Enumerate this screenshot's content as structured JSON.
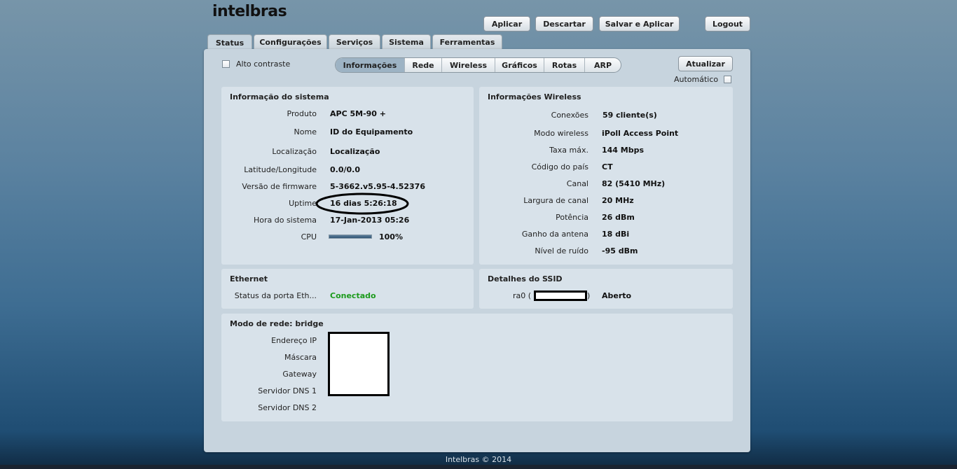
{
  "brand": "intelbras",
  "top_buttons": {
    "apply": "Aplicar",
    "discard": "Descartar",
    "save_apply": "Salvar e Aplicar",
    "logout": "Logout"
  },
  "main_tabs": [
    "Status",
    "Configurações",
    "Serviços",
    "Sistema",
    "Ferramentas"
  ],
  "high_contrast_label": "Alto contraste",
  "sub_tabs": [
    "Informações",
    "Rede",
    "Wireless",
    "Gráficos",
    "Rotas",
    "ARP"
  ],
  "update_button": "Atualizar",
  "auto_label": "Automático",
  "system_info": {
    "title": "Informação do sistema",
    "rows": [
      {
        "k": "Produto",
        "v": "APC 5M-90 +"
      },
      {
        "k": "Nome",
        "v": "ID do Equipamento"
      },
      {
        "k": "Localização",
        "v": "Localização"
      },
      {
        "k": "Latitude/Longitude",
        "v": "0.0/0.0"
      },
      {
        "k": "Versão de firmware",
        "v": "5-3662.v5.95-4.52376"
      },
      {
        "k": "Uptime",
        "v": "16 dias 5:26:18"
      },
      {
        "k": "Hora do sistema",
        "v": "17-Jan-2013 05:26"
      }
    ],
    "cpu_label": "CPU",
    "cpu_value": "100%",
    "cpu_fraction": 1.0
  },
  "wireless_info": {
    "title": "Informações Wireless",
    "rows": [
      {
        "k": "Conexões",
        "v": "59 cliente(s)"
      },
      {
        "k": "Modo wireless",
        "v": "iPoll Access Point"
      },
      {
        "k": "Taxa máx.",
        "v": "144 Mbps"
      },
      {
        "k": "Código do país",
        "v": "CT"
      },
      {
        "k": "Canal",
        "v": "82 (5410 MHz)"
      },
      {
        "k": "Largura de canal",
        "v": "20 MHz"
      },
      {
        "k": "Potência",
        "v": "26 dBm"
      },
      {
        "k": "Ganho da antena",
        "v": "18 dBi"
      },
      {
        "k": "Nível de ruído",
        "v": "-95 dBm"
      }
    ]
  },
  "ethernet": {
    "title": "Ethernet",
    "port_label": "Status da porta Eth...",
    "port_value": "Conectado",
    "status_color": "#1c9a1c"
  },
  "ssid": {
    "title": "Detalhes do SSID",
    "iface_prefix": "ra0 (",
    "iface_suffix": ")",
    "security": "Aberto"
  },
  "network": {
    "title": "Modo de rede: bridge",
    "labels": [
      "Endereço IP",
      "Máscara",
      "Gateway",
      "Servidor DNS 1",
      "Servidor DNS 2"
    ]
  },
  "footer": "Intelbras © 2014"
}
